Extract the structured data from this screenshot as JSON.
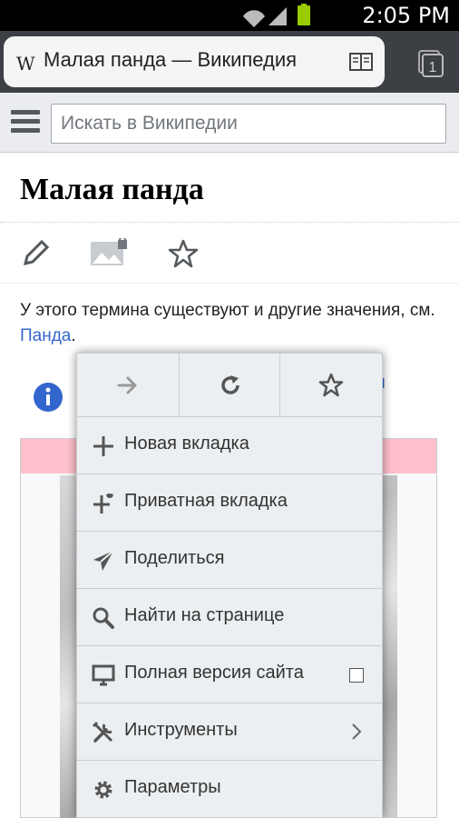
{
  "status_bar": {
    "time": "2:05 PM"
  },
  "browser_tab": {
    "logo": "W",
    "title": "Малая панда — Википедия",
    "tab_count": "1"
  },
  "search": {
    "placeholder": "Искать в Википедии"
  },
  "article": {
    "title": "Малая панда",
    "hatnote_text": "У этого термина существуют и другие значения, см. ",
    "hatnote_link": "Панда",
    "hatnote_end": ".",
    "link_fragment": "я"
  },
  "menu": {
    "top_buttons": [
      "forward-icon",
      "reload-icon",
      "bookmark-star-icon"
    ],
    "items": [
      {
        "label": "Новая вкладка",
        "icon": "plus-icon"
      },
      {
        "label": "Приватная вкладка",
        "icon": "private-tab-icon"
      },
      {
        "label": "Поделиться",
        "icon": "share-icon"
      },
      {
        "label": "Найти на странице",
        "icon": "search-icon"
      },
      {
        "label": "Полная версия сайта",
        "icon": "desktop-icon",
        "checked": false
      },
      {
        "label": "Инструменты",
        "icon": "tools-icon",
        "has_submenu": true
      },
      {
        "label": "Параметры",
        "icon": "gear-icon"
      }
    ]
  },
  "colors": {
    "link": "#3366cc",
    "infobox_header": "#ffc0cb",
    "toolbar": "#3c3f43"
  }
}
